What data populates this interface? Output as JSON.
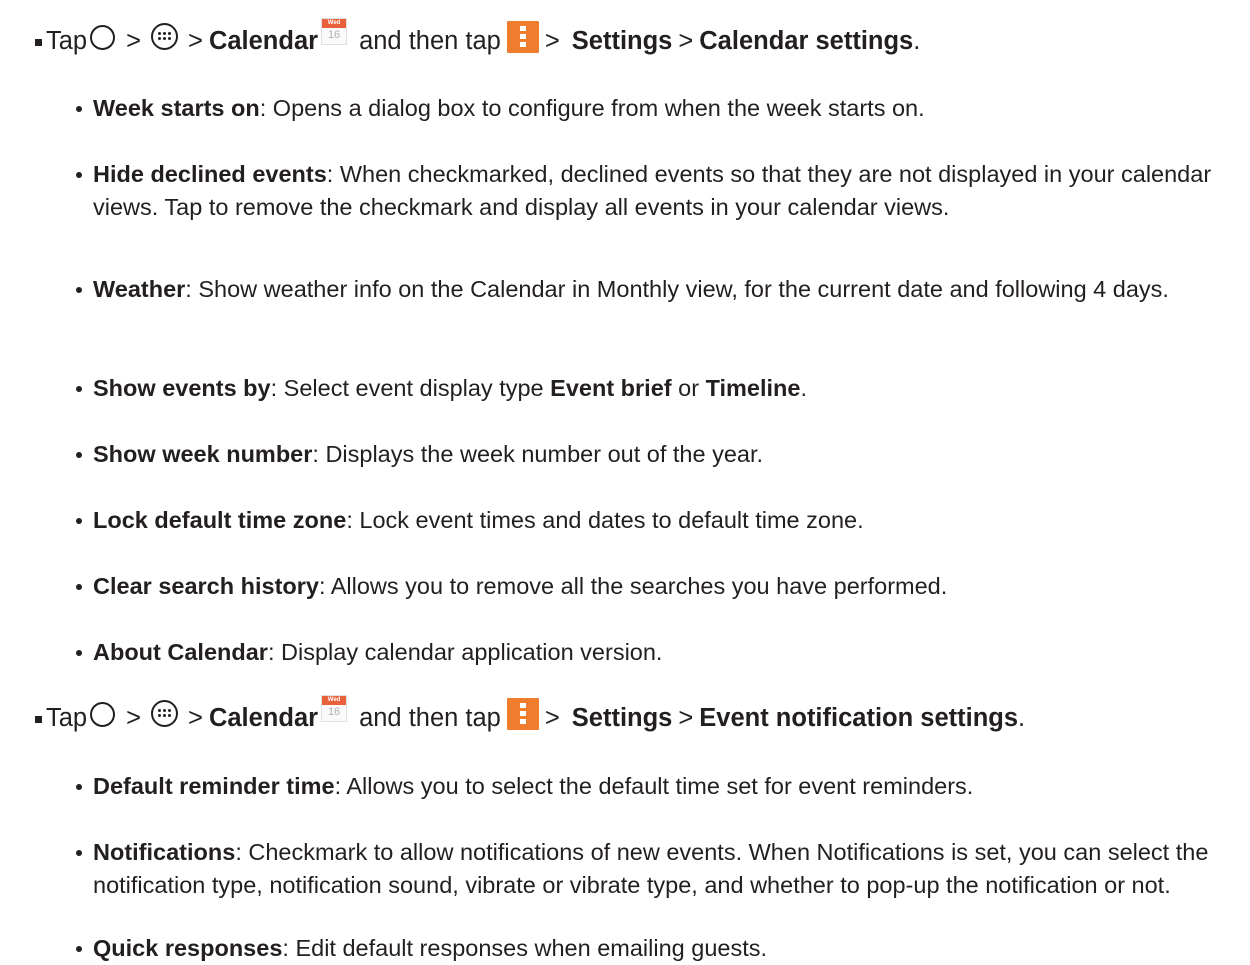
{
  "tap_words": {
    "tap": "Tap",
    "gt": ">",
    "and_then_tap": "and then tap",
    "period": "."
  },
  "icons": {
    "home": "home-circle-icon",
    "apps": "apps-grid-icon",
    "calendar": "calendar-app-icon",
    "menu": "menu-vertical-dots-icon",
    "calendar_day_label": "Wed",
    "calendar_day_number": "16",
    "calendar_header_color": "#e8613a",
    "menu_color": "#f07d2e"
  },
  "section1": {
    "calendar": "Calendar",
    "settings": "Settings",
    "target": "Calendar settings",
    "items": [
      {
        "term": "Week starts on",
        "desc": ": Opens a dialog box to configure from when the week starts on."
      },
      {
        "term": "Hide declined events",
        "desc": ": When checkmarked, declined events so that they are not displayed in your calendar views. Tap to remove the checkmark and display all events in your calendar views."
      },
      {
        "term": "Weather",
        "desc": ": Show weather info on the Calendar in Monthly view, for the current date and following 4 days."
      },
      {
        "term": "Show events by",
        "desc_a": ": Select event display type ",
        "opt1": "Event brief",
        "desc_b": " or ",
        "opt2": "Timeline",
        "desc_c": "."
      },
      {
        "term": "Show week number",
        "desc": ": Displays the week number out of the year."
      },
      {
        "term": "Lock default time zone",
        "desc": ": Lock event times and dates to default time zone."
      },
      {
        "term": "Clear search history",
        "desc": ": Allows you to remove all the searches you have performed."
      },
      {
        "term": "About Calendar",
        "desc": ": Display calendar application version."
      }
    ]
  },
  "section2": {
    "calendar": "Calendar",
    "settings": "Settings",
    "target": "Event notification settings",
    "items": [
      {
        "term": "Default reminder time",
        "desc": ": Allows you to select the default time set for event reminders."
      },
      {
        "term": "Notifications",
        "desc": ": Checkmark to allow notifications of new events. When Notifications is set, you can select the notification type, notification sound, vibrate or vibrate type, and whether to pop-up the notification or not."
      },
      {
        "term": "Quick responses",
        "desc": ": Edit default responses when emailing guests."
      }
    ]
  }
}
